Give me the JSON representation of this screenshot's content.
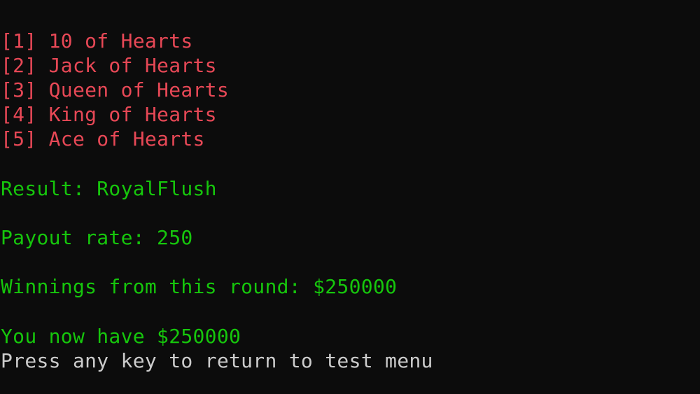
{
  "terminal": {
    "colors": {
      "background": "#0c0c0c",
      "card_text": "#e74856",
      "result_text": "#16c60c",
      "prompt_text": "#cccccc"
    },
    "cards": [
      "[1] 10 of Hearts",
      "[2] Jack of Hearts",
      "[3] Queen of Hearts",
      "[4] King of Hearts",
      "[5] Ace of Hearts"
    ],
    "result": "Result: RoyalFlush",
    "payout": "Payout rate: 250",
    "winnings": "Winnings from this round: $250000",
    "balance": "You now have $250000",
    "prompt": "Press any key to return to test menu"
  }
}
